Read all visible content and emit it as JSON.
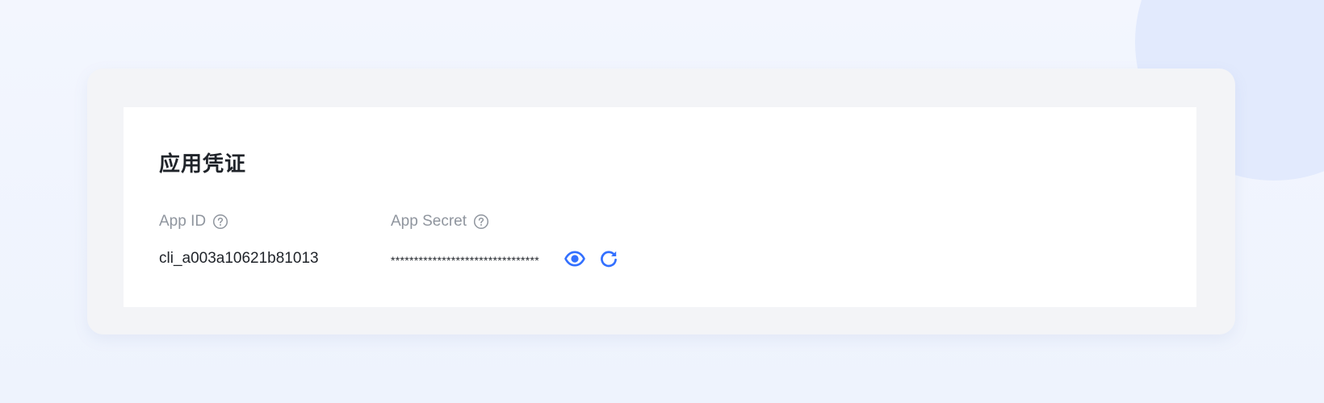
{
  "section": {
    "title": "应用凭证"
  },
  "credentials": {
    "app_id": {
      "label": "App ID",
      "value": "cli_a003a10621b81013",
      "help_icon": "question-circle-icon"
    },
    "app_secret": {
      "label": "App Secret",
      "value": "********************************",
      "help_icon": "question-circle-icon",
      "actions": {
        "show_icon": "eye-icon",
        "reset_icon": "refresh-icon"
      }
    }
  },
  "colors": {
    "background": "#eef3fd",
    "background_circle": "#e2eafd",
    "card_outer": "#f3f4f7",
    "card_inner": "#ffffff",
    "title_text": "#1f2329",
    "label_text": "#8f959e",
    "accent": "#3370ff"
  }
}
